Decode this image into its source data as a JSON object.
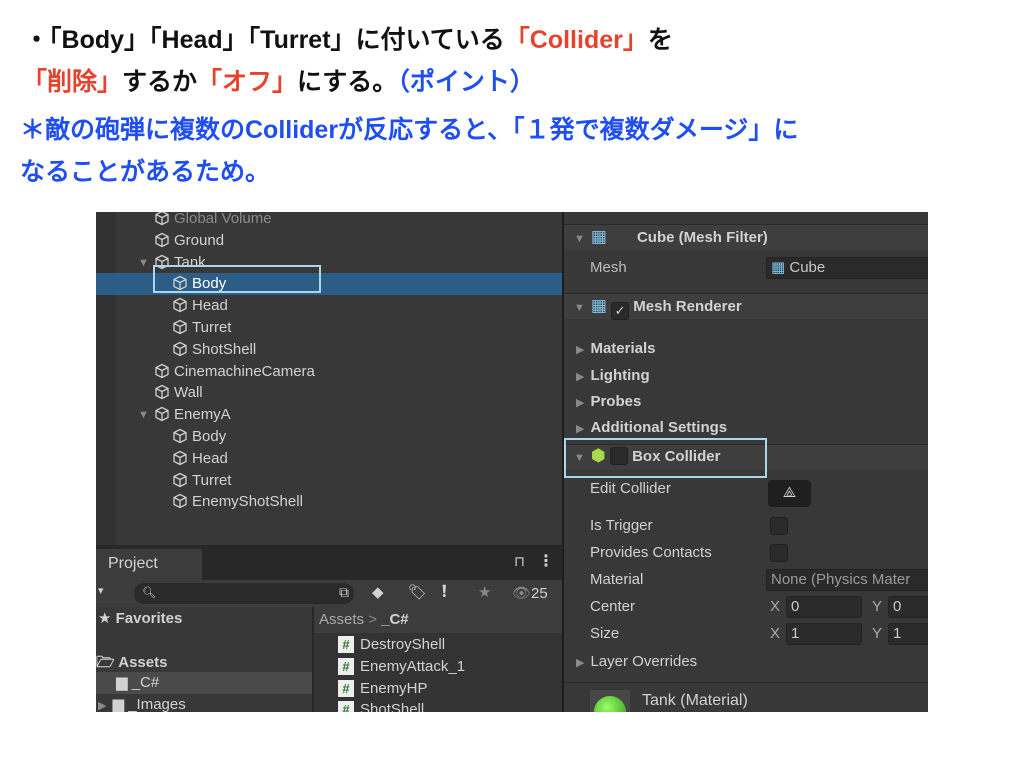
{
  "slide": {
    "line1": {
      "bullet": "・",
      "text": "「Body」「Head」「Turret」に付いている",
      "emph": "「Collider」",
      "tail": "を"
    },
    "line2": {
      "emph1": "「削除」",
      "mid": "するか",
      "emph2": "「オフ」",
      "tail": "にする。",
      "point": "（ポイント）"
    },
    "line3": "＊敵の砲弾に複数のColliderが反応すると、「１発で複数ダメージ」に",
    "line4": "なることがあるため。",
    "colors": {
      "red": "#e5432d",
      "blue": "#1f4ff0"
    }
  },
  "hierarchy": {
    "items": [
      {
        "label": "Global Volume",
        "indent": 0
      },
      {
        "label": "Ground",
        "indent": 0
      },
      {
        "label": "Tank",
        "indent": 0,
        "expanded": true
      },
      {
        "label": "Body",
        "indent": 1,
        "selected": true
      },
      {
        "label": "Head",
        "indent": 1
      },
      {
        "label": "Turret",
        "indent": 1
      },
      {
        "label": "ShotShell",
        "indent": 1
      },
      {
        "label": "CinemachineCamera",
        "indent": 0
      },
      {
        "label": "Wall",
        "indent": 0
      },
      {
        "label": "EnemyA",
        "indent": 0,
        "expanded": true
      },
      {
        "label": "Body",
        "indent": 1
      },
      {
        "label": "Head",
        "indent": 1
      },
      {
        "label": "Turret",
        "indent": 1
      },
      {
        "label": "EnemyShotShell",
        "indent": 1
      }
    ]
  },
  "project": {
    "tab": "Project",
    "count": "25",
    "favorites": "Favorites",
    "assets": "Assets",
    "folders": [
      "_C#",
      "_Images"
    ],
    "breadcrumb": {
      "root": "Assets",
      "sep": ">",
      "current": "_C#"
    },
    "files": [
      "DestroyShell",
      "EnemyAttack_1",
      "EnemyHP",
      "ShotShell"
    ]
  },
  "inspector": {
    "mesh_filter": {
      "title": "Cube (Mesh Filter)",
      "mesh_label": "Mesh",
      "mesh_value": "Cube"
    },
    "mesh_renderer": {
      "title": "Mesh Renderer",
      "enabled": true,
      "sections": [
        "Materials",
        "Lighting",
        "Probes",
        "Additional Settings"
      ]
    },
    "box_collider": {
      "title": "Box Collider",
      "enabled": false,
      "edit_collider": "Edit Collider",
      "is_trigger": "Is Trigger",
      "provides_contacts": "Provides Contacts",
      "material_label": "Material",
      "material_value": "None (Physics Mater",
      "center_label": "Center",
      "size_label": "Size",
      "x": "X",
      "y": "Y",
      "center": {
        "x": "0",
        "y": "0"
      },
      "size": {
        "x": "1",
        "y": "1"
      },
      "layer_overrides": "Layer Overrides"
    },
    "material": "Tank (Material)"
  }
}
